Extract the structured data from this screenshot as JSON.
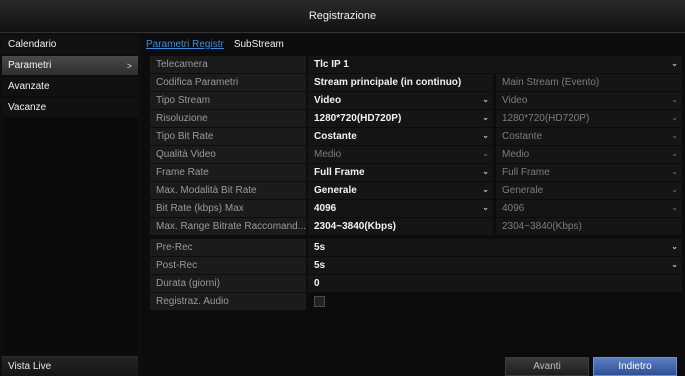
{
  "window": {
    "title": "Registrazione"
  },
  "sidebar": {
    "items": [
      {
        "label": "Calendario",
        "active": false
      },
      {
        "label": "Parametri",
        "active": true,
        "chevron": ">"
      },
      {
        "label": "Avanzate",
        "active": false
      },
      {
        "label": "Vacanze",
        "active": false
      }
    ],
    "bottom_label": "Vista Live"
  },
  "tabs": [
    {
      "label": "Parametri Registr",
      "active": true
    },
    {
      "label": "SubStream",
      "active": false
    }
  ],
  "params": {
    "camera": {
      "label": "Telecamera",
      "value": "Tlc IP 1"
    },
    "encoding": {
      "label": "Codifica Parametri",
      "main": "Stream principale (in continuo)",
      "event": "Main Stream (Evento)"
    },
    "stream_type": {
      "label": "Tipo Stream",
      "main": "Video",
      "event": "Video"
    },
    "resolution": {
      "label": "Risoluzione",
      "main": "1280*720(HD720P)",
      "event": "1280*720(HD720P)"
    },
    "bitrate_type": {
      "label": "Tipo Bit Rate",
      "main": "Costante",
      "event": "Costante"
    },
    "video_quality": {
      "label": "Qualità Video",
      "main": "Medio",
      "event": "Medio"
    },
    "frame_rate": {
      "label": "Frame Rate",
      "main": "Full Frame",
      "event": "Full Frame"
    },
    "max_bitrate_mode": {
      "label": "Max. Modalità Bit Rate",
      "main": "Generale",
      "event": "Generale"
    },
    "bitrate_max": {
      "label": "Bit Rate (kbps) Max",
      "main": "4096",
      "event": "4096"
    },
    "max_range": {
      "label": "Max. Range Bitrate Raccomand...",
      "main": "2304~3840(Kbps)",
      "event": "2304~3840(Kbps)"
    },
    "pre_rec": {
      "label": "Pre-Rec",
      "value": "5s"
    },
    "post_rec": {
      "label": "Post-Rec",
      "value": "5s"
    },
    "duration": {
      "label": "Durata (giorni)",
      "value": "0"
    },
    "audio": {
      "label": "Registraz. Audio",
      "checked": false
    }
  },
  "buttons": {
    "next": "Avanti",
    "back": "Indietro"
  },
  "icons": {
    "dropdown": "chevron-down-icon",
    "chevron_right": "chevron-right-icon"
  },
  "colors": {
    "accent": "#3a8fe0",
    "button_primary": "#3f63ab"
  }
}
